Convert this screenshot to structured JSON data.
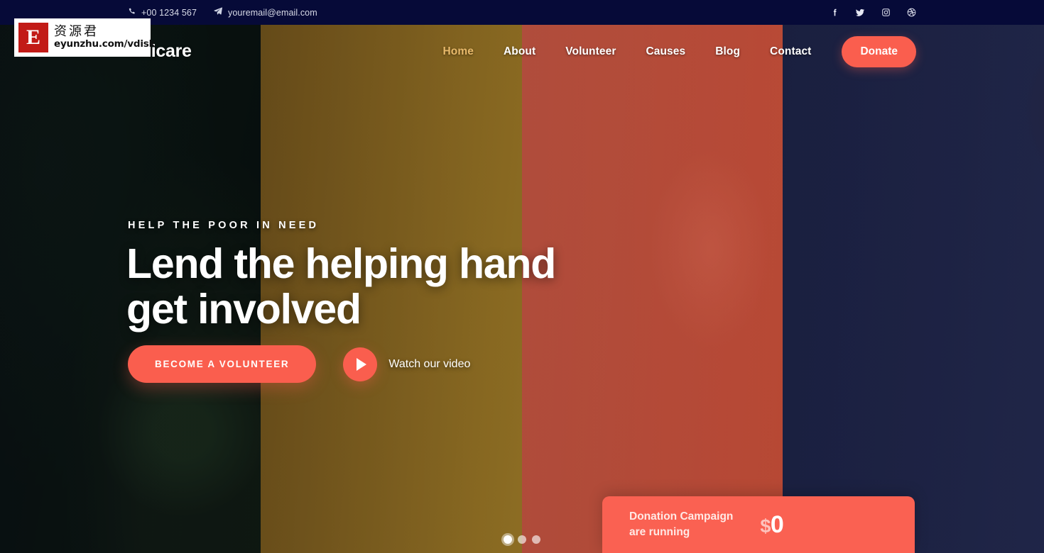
{
  "topbar": {
    "phone": "+00 1234 567",
    "email": "youremail@email.com",
    "phone_icon": "phone-icon",
    "email_icon": "paper-plane-icon",
    "socials": [
      {
        "name": "facebook-icon",
        "label": "Facebook"
      },
      {
        "name": "twitter-icon",
        "label": "Twitter"
      },
      {
        "name": "instagram-icon",
        "label": "Instagram"
      },
      {
        "name": "dribbble-icon",
        "label": "Dribbble"
      }
    ],
    "background_color": "#060a38"
  },
  "nav": {
    "brand": "Unicare",
    "items": [
      {
        "label": "Home",
        "active": true
      },
      {
        "label": "About",
        "active": false
      },
      {
        "label": "Volunteer",
        "active": false
      },
      {
        "label": "Causes",
        "active": false
      },
      {
        "label": "Blog",
        "active": false
      },
      {
        "label": "Contact",
        "active": false
      }
    ],
    "donate_label": "Donate",
    "active_color": "#e8b96a",
    "accent_color": "#fa5e4e"
  },
  "hero": {
    "eyebrow": "HELP THE POOR IN NEED",
    "headline_line1": "Lend the helping hand",
    "headline_line2": "get involved",
    "primary_cta": "BECOME A VOLUNTEER",
    "video_label": "Watch our video",
    "play_icon": "play-icon"
  },
  "carousel": {
    "slides": 3,
    "active_index": 0
  },
  "donation": {
    "line1": "Donation Campaign",
    "line2": "are running",
    "currency": "$",
    "amount": "0",
    "background_color": "#fa6152"
  },
  "watermark": {
    "mark": "E",
    "chinese": "资源君",
    "url": "eyunzhu.com/vdisk",
    "mark_color": "#c21b17"
  }
}
